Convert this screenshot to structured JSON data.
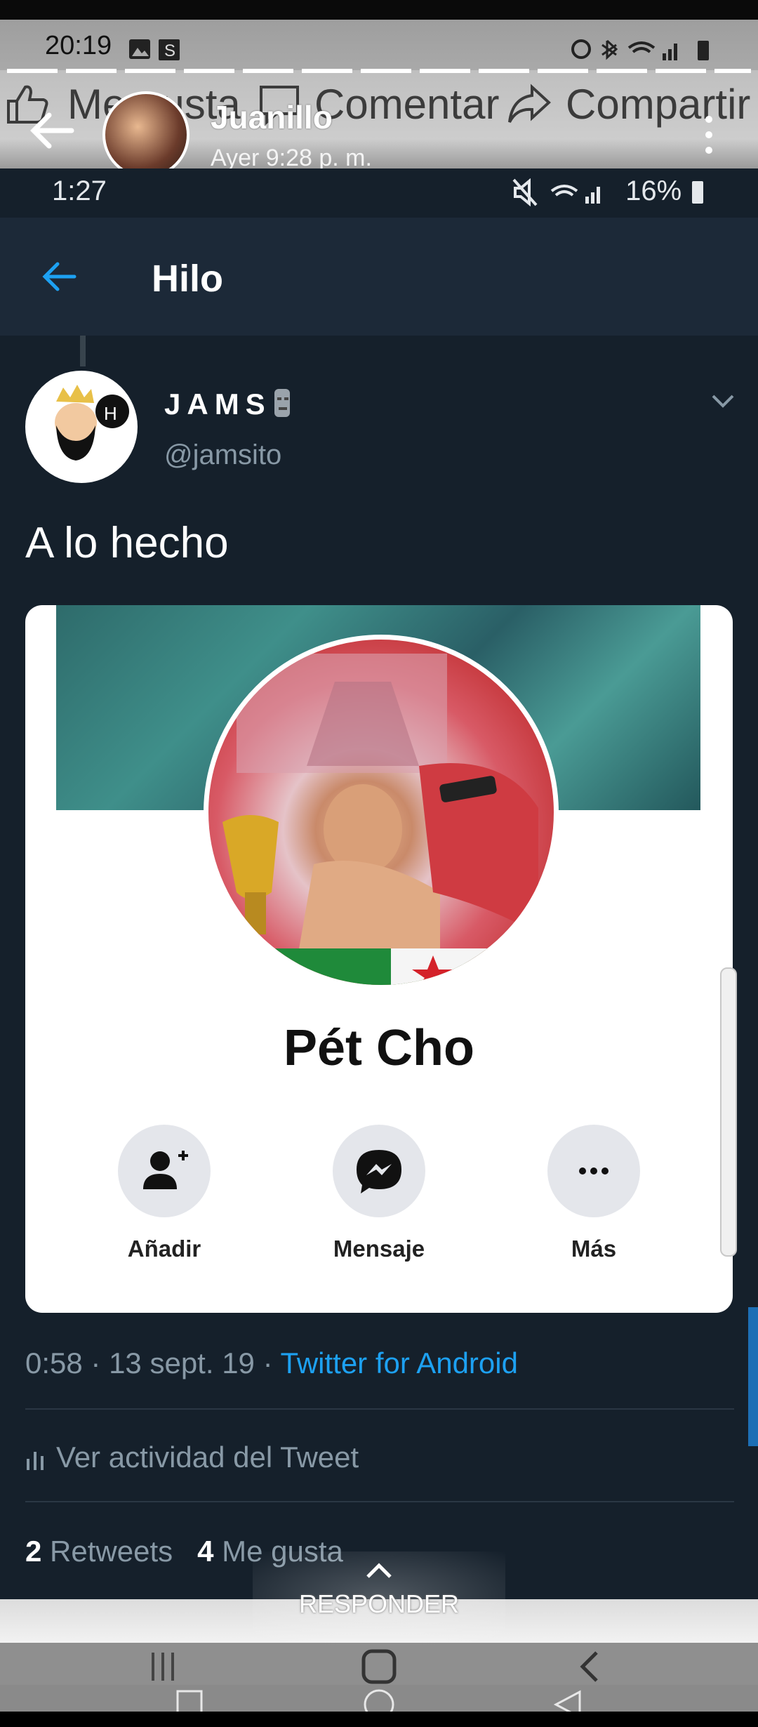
{
  "outer_status": {
    "time": "20:19"
  },
  "fb_viewer": {
    "behind_bar": {
      "like": "Me gusta",
      "comment": "Comentar",
      "share": "Compartir"
    },
    "sender_name": "Juanillo",
    "sender_time": "Ayer 9:28 p. m.",
    "reply_label": "RESPONDER"
  },
  "tweet_screen": {
    "status": {
      "time": "1:27",
      "battery": "16%"
    },
    "header_title": "Hilo",
    "author": {
      "name": "JAMS",
      "handle": "@jamsito"
    },
    "text": "A lo hecho",
    "card": {
      "profile_name": "Pét Cho",
      "actions": [
        {
          "label": "Añadir",
          "icon": "add-friend-icon"
        },
        {
          "label": "Mensaje",
          "icon": "messenger-icon"
        },
        {
          "label": "Más",
          "icon": "more-icon"
        }
      ]
    },
    "meta": {
      "time": "0:58",
      "date": "13 sept. 19",
      "source": "Twitter for Android"
    },
    "activity_label": "Ver actividad del Tweet",
    "stats": {
      "retweets_count": "2",
      "retweets_label": "Retweets",
      "likes_count": "4",
      "likes_label": "Me gusta"
    }
  },
  "colors": {
    "twitter_bg": "#15202b",
    "twitter_header": "#1c2938",
    "twitter_blue": "#1da1f2",
    "muted": "#8899a6"
  }
}
